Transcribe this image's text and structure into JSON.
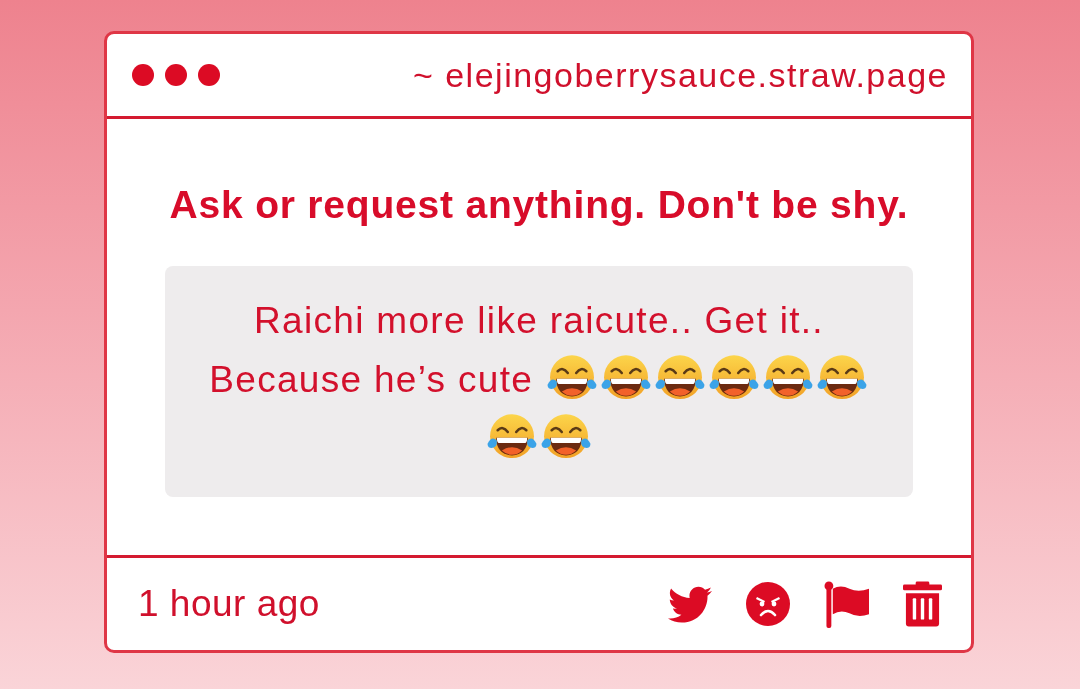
{
  "window": {
    "url": "~ elejingoberrysauce.straw.page"
  },
  "prompt": "Ask or request anything. Don't be shy.",
  "message": {
    "lines": [
      "Raichi more like raicute.. Get it..",
      "Because he’s cute"
    ],
    "emoji": [
      {
        "kind": "tears-of-joy"
      },
      {
        "kind": "tears-of-joy"
      },
      {
        "kind": "tears-of-joy"
      },
      {
        "kind": "tears-of-joy"
      },
      {
        "kind": "tears-of-joy"
      },
      {
        "kind": "tears-of-joy"
      },
      {
        "kind": "tears-of-joy"
      },
      {
        "kind": "tears-of-joy"
      }
    ]
  },
  "footer": {
    "time": "1 hour ago"
  }
}
